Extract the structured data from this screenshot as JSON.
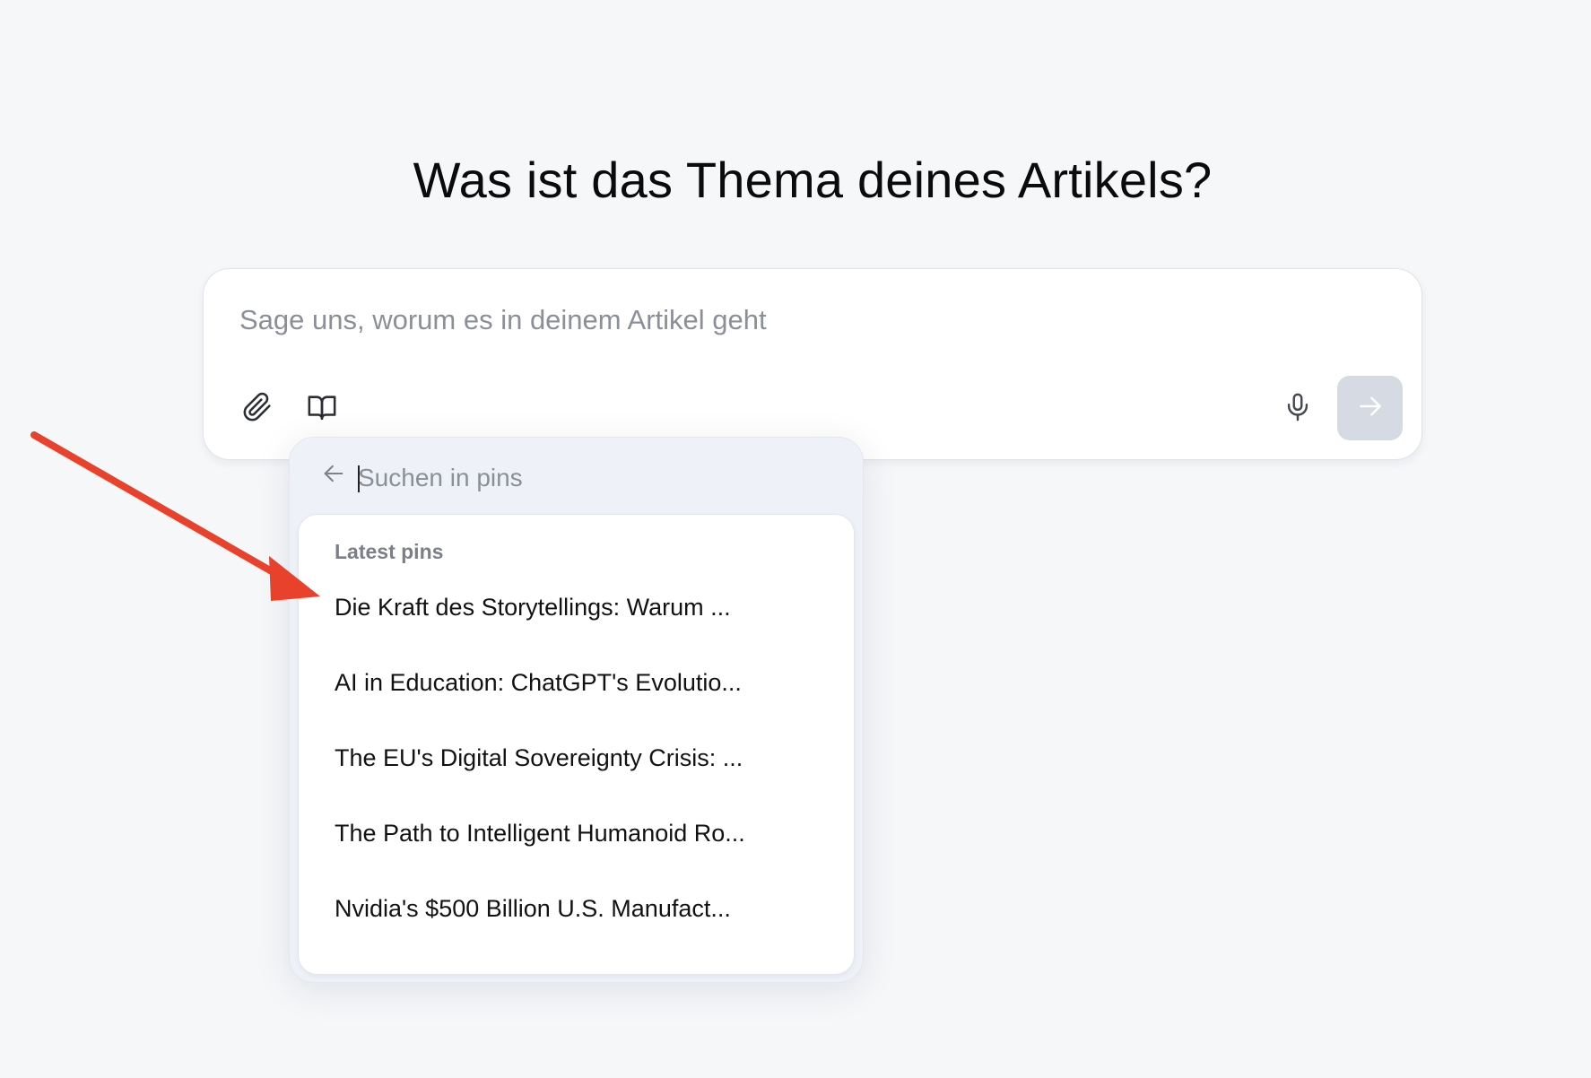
{
  "page": {
    "title": "Was ist das Thema deines Artikels?"
  },
  "composer": {
    "placeholder": "Sage uns, worum es in deinem Artikel geht",
    "icons": {
      "attach": "paperclip-icon",
      "knowledge": "book-open-icon",
      "voice": "microphone-icon",
      "send": "arrow-right-icon"
    }
  },
  "pin_picker": {
    "search_placeholder": "Suchen in pins",
    "back_icon": "arrow-left-icon",
    "section_label": "Latest pins",
    "items": [
      {
        "label": "Die Kraft des Storytellings: Warum ..."
      },
      {
        "label": "AI in Education: ChatGPT's Evolutio..."
      },
      {
        "label": "The EU's Digital Sovereignty Crisis: ..."
      },
      {
        "label": "The Path to Intelligent Humanoid Ro..."
      },
      {
        "label": "Nvidia's $500 Billion U.S. Manufact..."
      }
    ]
  },
  "annotation": {
    "arrow_color": "#e8412c"
  }
}
